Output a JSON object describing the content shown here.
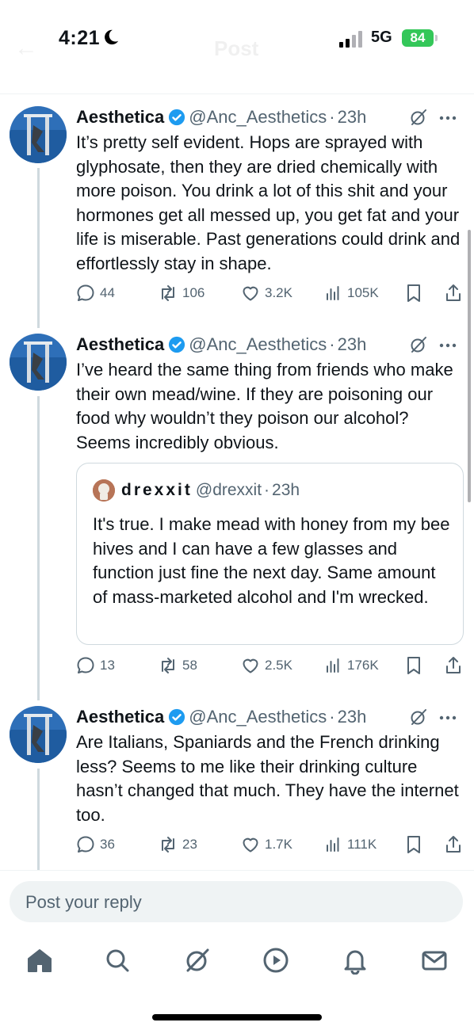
{
  "status_bar": {
    "time": "4:21",
    "network": "5G",
    "battery": "84"
  },
  "header": {
    "title": "Post"
  },
  "posts": [
    {
      "author": "Aesthetica",
      "handle": "@Anc_Aesthetics",
      "separator": "·",
      "time_ago": "23h",
      "text": "It’s pretty self evident. Hops are sprayed with glyphosate, then they are dried chemically with more poison. You drink a lot of this shit and your hormones get all messed up, you get fat and your life is miserable. Past generations could drink and effortlessly stay in shape.",
      "stats": {
        "replies": "44",
        "reposts": "106",
        "likes": "3.2K",
        "views": "105K"
      }
    },
    {
      "author": "Aesthetica",
      "handle": "@Anc_Aesthetics",
      "separator": "·",
      "time_ago": "23h",
      "text": "I’ve heard the same thing from friends who make their own mead/wine. If they are poisoning our food why wouldn’t they poison our alcohol? Seems incredibly obvious.",
      "quote": {
        "author": "drexxit",
        "handle": "@drexxit",
        "separator": "·",
        "time_ago": "23h",
        "text": "It's true. I make mead with honey from my bee hives and I can have a few glasses and function just fine the next day. Same amount of mass-marketed alcohol and I'm wrecked."
      },
      "stats": {
        "replies": "13",
        "reposts": "58",
        "likes": "2.5K",
        "views": "176K"
      }
    },
    {
      "author": "Aesthetica",
      "handle": "@Anc_Aesthetics",
      "separator": "·",
      "time_ago": "23h",
      "text": "Are Italians, Spaniards and the French drinking less? Seems to me like their drinking culture hasn’t changed that much. They have the internet too.",
      "stats": {
        "replies": "36",
        "reposts": "23",
        "likes": "1.7K",
        "views": "111K"
      }
    }
  ],
  "reply": {
    "placeholder": "Post your reply"
  },
  "nav": [
    "home-icon",
    "search-icon",
    "grok-icon",
    "video-icon",
    "notifications-icon",
    "messages-icon"
  ],
  "colors": {
    "text": "#0f1419",
    "secondary": "#536471",
    "verified": "#1d9bf0",
    "battery": "#34c759",
    "divider": "#eff3f4"
  }
}
